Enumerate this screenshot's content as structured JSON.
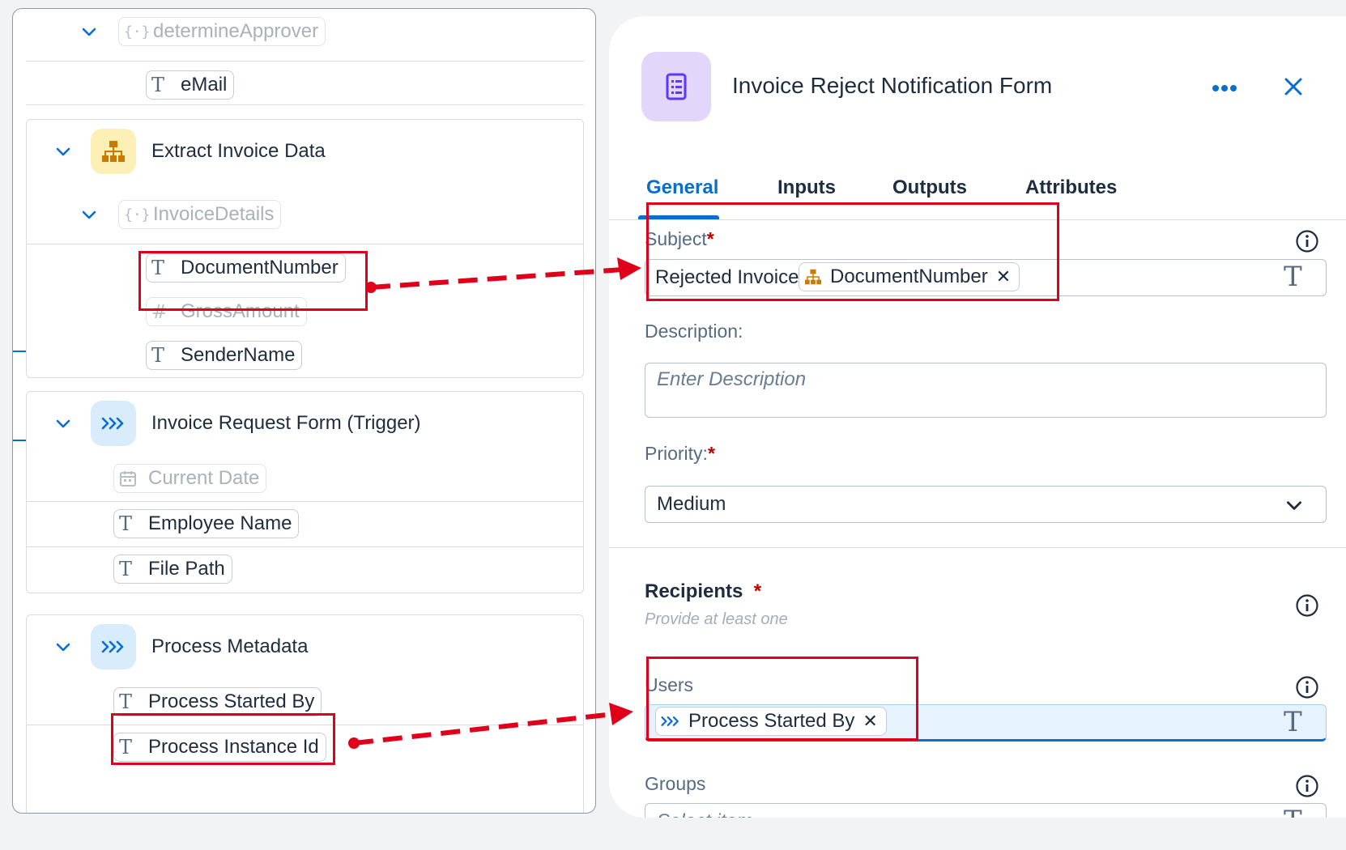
{
  "left_panel": {
    "groups": [
      {
        "title": "",
        "rows": [
          {
            "icon": "object-icon",
            "label": "determineApprover",
            "muted": true
          },
          {
            "icon": "text-type-icon",
            "label": "eMail",
            "muted": false
          }
        ]
      },
      {
        "title": "Extract Invoice Data",
        "icon": "hierarchy-icon",
        "icon_bg": "#fdf0b7",
        "rows": [
          {
            "icon": "object-icon",
            "label": "InvoiceDetails",
            "muted": true
          },
          {
            "icon": "text-type-icon",
            "label": "DocumentNumber",
            "muted": false
          },
          {
            "icon": "number-type-icon",
            "label": "GrossAmount",
            "muted": true
          },
          {
            "icon": "text-type-icon",
            "label": "SenderName",
            "muted": false
          }
        ]
      },
      {
        "title": "Invoice Request Form (Trigger)",
        "icon": "trigger-icon",
        "icon_bg": "#d8ecfc",
        "rows": [
          {
            "icon": "calendar-icon",
            "label": "Current Date",
            "muted": true
          },
          {
            "icon": "text-type-icon",
            "label": "Employee Name",
            "muted": false
          },
          {
            "icon": "text-type-icon",
            "label": "File Path",
            "muted": false
          }
        ]
      },
      {
        "title": "Process Metadata",
        "icon": "trigger-icon",
        "icon_bg": "#d8ecfc",
        "rows": [
          {
            "icon": "text-type-icon",
            "label": "Process Started By",
            "muted": false
          },
          {
            "icon": "text-type-icon",
            "label": "Process Instance Id",
            "muted": false
          }
        ]
      }
    ]
  },
  "right_panel": {
    "title": "Invoice Reject Notification Form",
    "header_icon": "form-icon",
    "tabs": [
      "General",
      "Inputs",
      "Outputs",
      "Attributes"
    ],
    "active_tab": "General",
    "subject": {
      "label": "Subject",
      "required": "*",
      "static_text": "Rejected Invoice",
      "token": "DocumentNumber",
      "token_icon": "hierarchy-icon"
    },
    "description": {
      "label": "Description:",
      "placeholder": "Enter Description"
    },
    "priority": {
      "label": "Priority:",
      "required": "*",
      "value": "Medium"
    },
    "recipients": {
      "title": "Recipients",
      "required": "*",
      "hint": "Provide at least one"
    },
    "users": {
      "label": "Users",
      "token": "Process Started By",
      "token_icon": "trigger-icon"
    },
    "groups": {
      "label": "Groups",
      "placeholder": "Select item"
    }
  },
  "colors": {
    "accent": "#0a6ed1",
    "highlight_red": "#e0001a",
    "required_red": "#bb0000",
    "hierarchy_icon": "#c87b00",
    "form_icon": "#5d36ff"
  }
}
